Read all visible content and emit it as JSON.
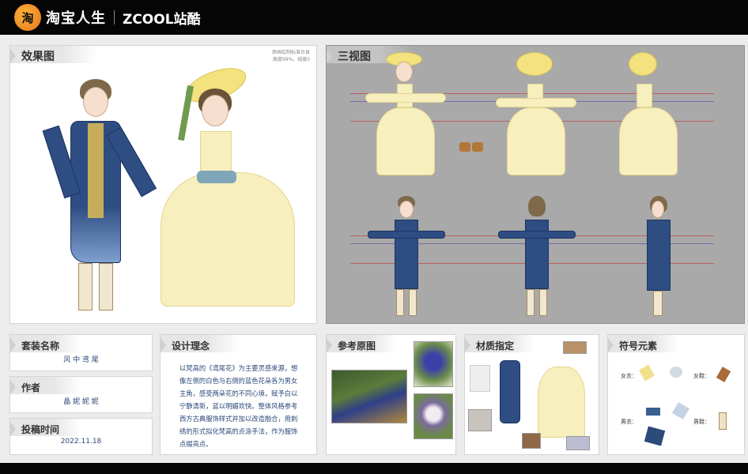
{
  "header": {
    "logo_icon": "taobao-life-logo",
    "brand_cn": "淘宝人生",
    "brand_zcool": "ZCOOL站酷"
  },
  "panels": {
    "effect": {
      "title": "效果图",
      "note_line1": "原画绘制标准台县",
      "note_line2": "高度99%，线度0"
    },
    "three_view": {
      "title": "三视图"
    },
    "suit_name": {
      "title": "套装名称",
      "value": "风 中 鸢 尾"
    },
    "author": {
      "title": "作者",
      "value": "晶 妮 妮 妮"
    },
    "date": {
      "title": "投稿时间",
      "value": "2022.11.18"
    },
    "concept": {
      "title": "设计理念",
      "text": "以梵高的《鸢尾花》为主要灵感来源，想像左侧的白色与右侧的蓝色花朵各为男女主角，感受两朵花的不同心境，赋予白以宁静清新，蓝以明媚欢快。整体风格参考西方古典服饰样式并加以改造融合，用刺绣的形式拟化梵高的点涂手法，作为服饰点缀亮点。"
    },
    "reference": {
      "title": "参考原图"
    },
    "material": {
      "title": "材质指定"
    },
    "symbols": {
      "title": "符号元素",
      "female_top": "女衣：",
      "female_shoes": "女鞋：",
      "male_top": "男衣：",
      "male_shoes": "男鞋："
    }
  },
  "colors": {
    "navy": "#2e4d82",
    "cream": "#f7efbe",
    "hat": "#f3e27d",
    "sheet_bg": "#a9a9a9"
  }
}
